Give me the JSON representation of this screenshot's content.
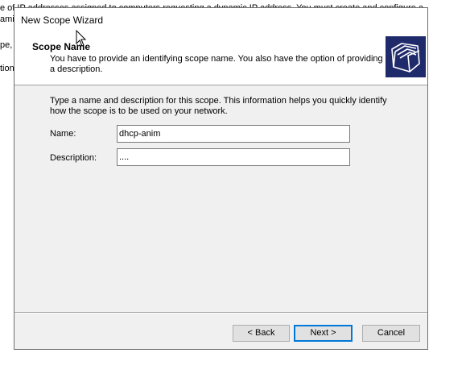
{
  "background": {
    "line1": "e of IP addresses assigned to computers requesting a dynamic IP address. You must create and configure a",
    "line2": "ami",
    "line3": "pe,",
    "line4": "tion"
  },
  "window": {
    "title": "New Scope Wizard"
  },
  "header": {
    "title": "Scope Name",
    "description": "You have to provide an identifying scope name. You also have the option of providing a description.",
    "icon": "scope-folders-icon"
  },
  "body": {
    "description": "Type a name and description for this scope. This information helps you quickly identify how the scope is to be used on your network.",
    "name_label": "Name:",
    "name_value": "dhcp-anim",
    "description_label": "Description:",
    "description_value": "...."
  },
  "buttons": {
    "back": "< Back",
    "next": "Next >",
    "cancel": "Cancel"
  },
  "colors": {
    "icon_background": "#1f2a6b",
    "default_button_border": "#0078d7"
  }
}
